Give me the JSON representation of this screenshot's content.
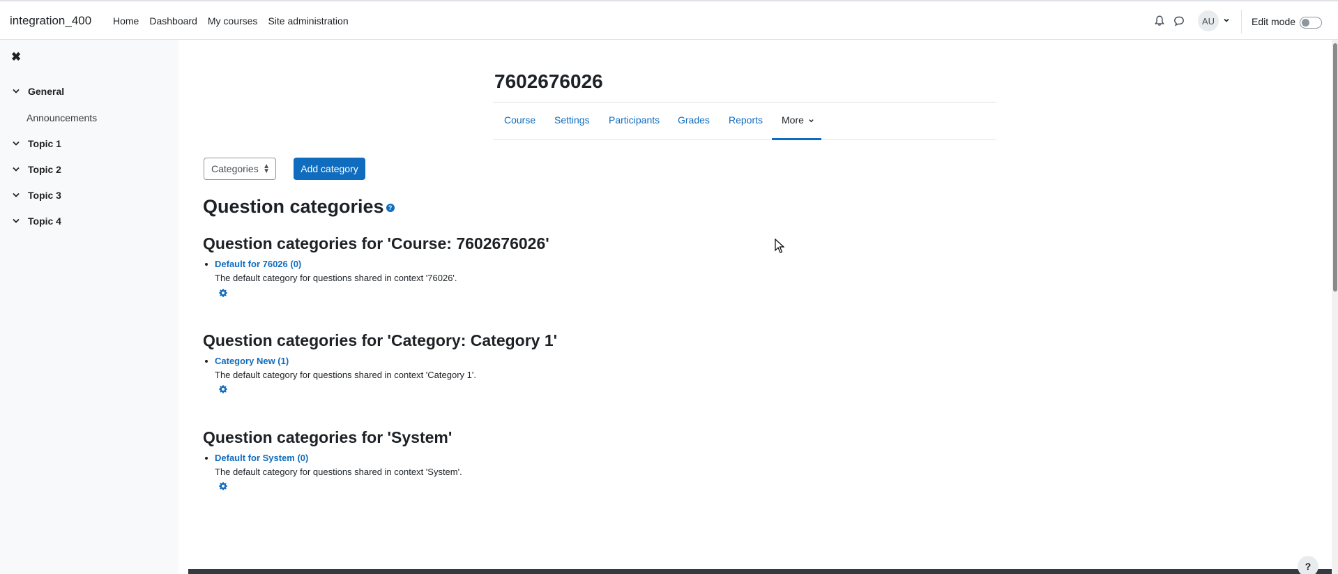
{
  "navbar": {
    "brand": "integration_400",
    "items": [
      "Home",
      "Dashboard",
      "My courses",
      "Site administration"
    ],
    "avatar_initials": "AU",
    "edit_mode_label": "Edit mode"
  },
  "drawer": {
    "close_icon": "close-icon",
    "sections": [
      {
        "label": "General",
        "expanded": true,
        "children": [
          "Announcements"
        ]
      },
      {
        "label": "Topic 1",
        "expanded": true
      },
      {
        "label": "Topic 2",
        "expanded": true
      },
      {
        "label": "Topic 3",
        "expanded": true
      },
      {
        "label": "Topic 4",
        "expanded": true
      }
    ]
  },
  "course": {
    "title": "7602676026",
    "tabs": [
      "Course",
      "Settings",
      "Participants",
      "Grades",
      "Reports",
      "More"
    ],
    "active_tab": "More"
  },
  "toolbar": {
    "select_value": "Categories",
    "add_button": "Add category"
  },
  "page": {
    "heading": "Question categories",
    "contexts": [
      {
        "heading": "Question categories for 'Course: 7602676026'",
        "category": "Default for 76026 (0)",
        "description": "The default category for questions shared in context '76026'."
      },
      {
        "heading": "Question categories for 'Category: Category 1'",
        "category": "Category New (1)",
        "description": "The default category for questions shared in context 'Category 1'."
      },
      {
        "heading": "Question categories for 'System'",
        "category": "Default for System (0)",
        "description": "The default category for questions shared in context 'System'."
      }
    ]
  },
  "footer": {
    "help_label": "?"
  },
  "colors": {
    "primary": "#0f6cbf",
    "text": "#1d2125",
    "drawer_bg": "#f8f9fa",
    "border": "#dee2e6"
  }
}
